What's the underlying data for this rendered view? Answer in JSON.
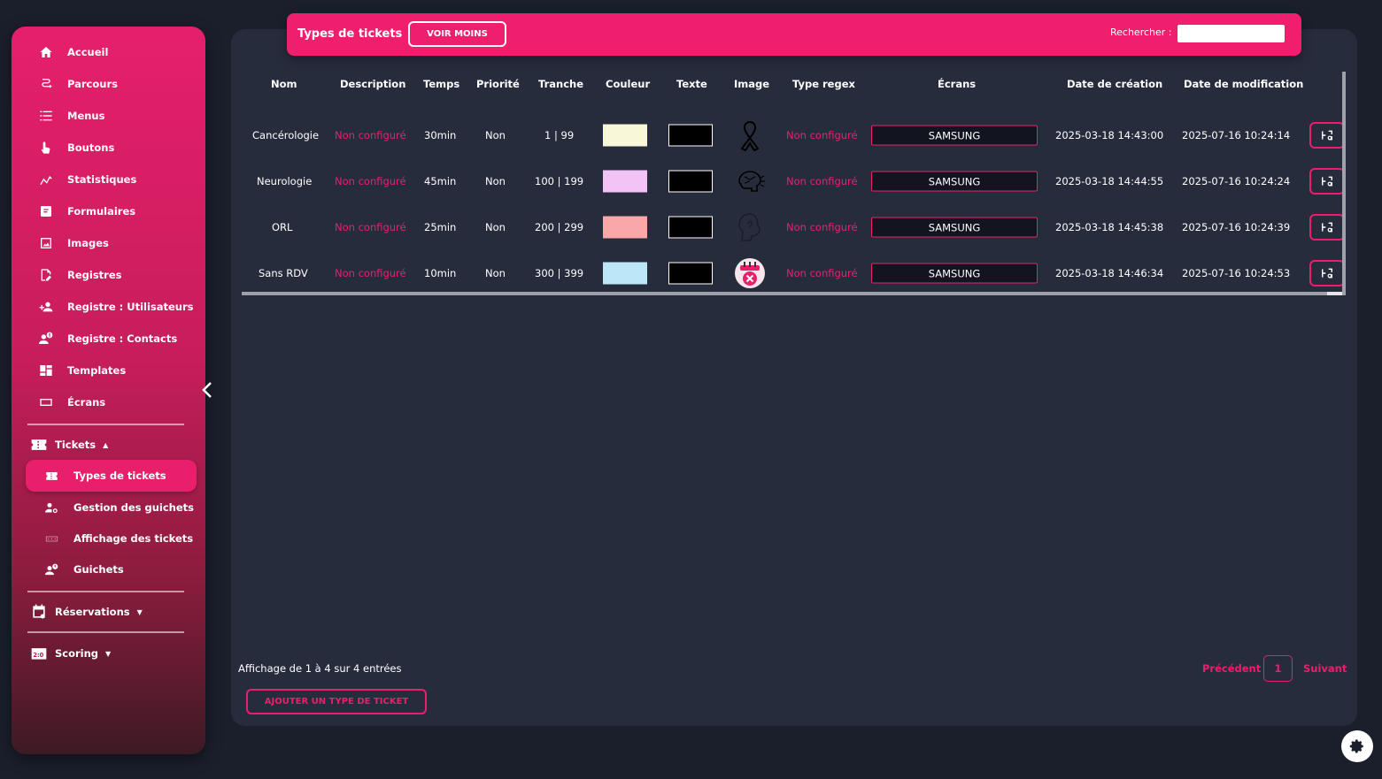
{
  "sidebar": {
    "items": [
      {
        "label": "Accueil",
        "icon": "home-icon"
      },
      {
        "label": "Parcours",
        "icon": "route-icon"
      },
      {
        "label": "Menus",
        "icon": "list-icon"
      },
      {
        "label": "Boutons",
        "icon": "touch-icon"
      },
      {
        "label": "Statistiques",
        "icon": "stats-icon"
      },
      {
        "label": "Formulaires",
        "icon": "form-icon"
      },
      {
        "label": "Images",
        "icon": "image-icon"
      },
      {
        "label": "Registres",
        "icon": "register-icon"
      },
      {
        "label": "Registre : Utilisateurs",
        "icon": "user-add-icon"
      },
      {
        "label": "Registre : Contacts",
        "icon": "contacts-icon"
      },
      {
        "label": "Templates",
        "icon": "templates-icon"
      },
      {
        "label": "Écrans",
        "icon": "screen-icon"
      }
    ],
    "tickets_group": {
      "label": "Tickets",
      "sub_items": [
        {
          "label": "Types de tickets",
          "icon": "ticket-icon"
        },
        {
          "label": "Gestion des guichets",
          "icon": "counter-manage-icon"
        },
        {
          "label": "Affichage des tickets",
          "icon": "ticket-display-icon"
        },
        {
          "label": "Guichets",
          "icon": "counter-icon"
        }
      ]
    },
    "reservations_label": "Réservations",
    "scoring_label": "Scoring"
  },
  "header": {
    "title": "Types de tickets",
    "toggle_label": "VOIR MOINS",
    "search_label": "Rechercher :",
    "search_value": ""
  },
  "table": {
    "columns": [
      "Nom",
      "Description",
      "Temps",
      "Priorité",
      "Tranche",
      "Couleur",
      "Texte",
      "Image",
      "Type regex",
      "Écrans",
      "Date de création",
      "Date de modification"
    ],
    "rows": [
      {
        "nom": "Cancérologie",
        "description": "Non configuré",
        "temps": "30min",
        "priorite": "Non",
        "tranche": "1 | 99",
        "couleur": "#f8f8d8",
        "texte": "#000000",
        "image": "ribbon-icon",
        "regex": "Non configuré",
        "ecran": "SAMSUNG",
        "creation": "2025-03-18 14:43:00",
        "modification": "2025-07-16 10:24:14"
      },
      {
        "nom": "Neurologie",
        "description": "Non configuré",
        "temps": "45min",
        "priorite": "Non",
        "tranche": "100 | 199",
        "couleur": "#f3c3f6",
        "texte": "#000000",
        "image": "brain-icon",
        "regex": "Non configuré",
        "ecran": "SAMSUNG",
        "creation": "2025-03-18 14:44:55",
        "modification": "2025-07-16 10:24:24"
      },
      {
        "nom": "ORL",
        "description": "Non configuré",
        "temps": "25min",
        "priorite": "Non",
        "tranche": "200 | 299",
        "couleur": "#f9a7a7",
        "texte": "#000000",
        "image": "ear-head-icon",
        "regex": "Non configuré",
        "ecran": "SAMSUNG",
        "creation": "2025-03-18 14:45:38",
        "modification": "2025-07-16 10:24:39"
      },
      {
        "nom": "Sans RDV",
        "description": "Non configuré",
        "temps": "10min",
        "priorite": "Non",
        "tranche": "300 | 399",
        "couleur": "#bde7f9",
        "texte": "#000000",
        "image": "calendar-cancel-icon",
        "regex": "Non configuré",
        "ecran": "SAMSUNG",
        "creation": "2025-03-18 14:46:34",
        "modification": "2025-07-16 10:24:53"
      }
    ]
  },
  "footer": {
    "info": "Affichage de 1 à 4 sur 4 entrées",
    "prev_label": "Précédent",
    "page": "1",
    "next_label": "Suivant",
    "add_label": "AJOUTER UN TYPE DE TICKET"
  },
  "colors": {
    "accent": "#e8206c",
    "card": "#272c3d",
    "background": "#1b1f2c"
  }
}
